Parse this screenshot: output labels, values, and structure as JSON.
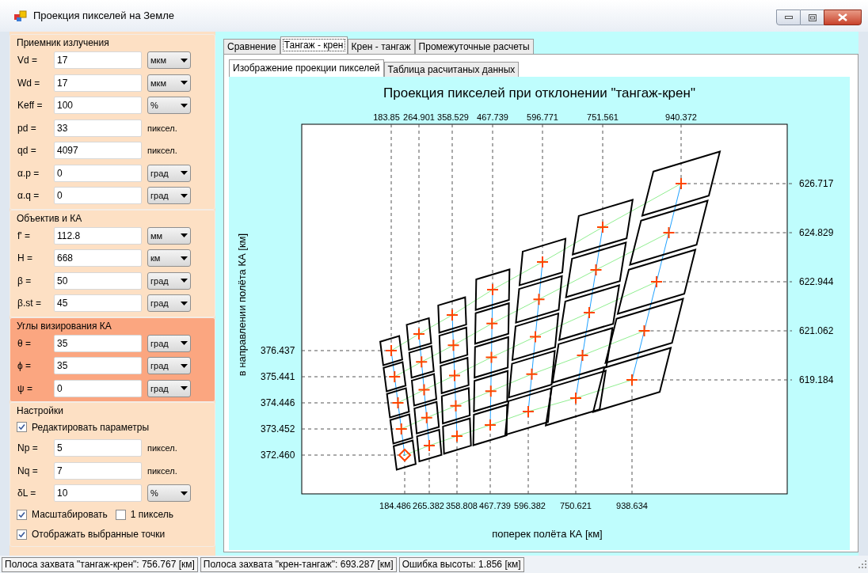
{
  "window": {
    "title": "Проекция пикселей на Земле"
  },
  "groups": [
    {
      "title": "Приемник излучения",
      "highlighted": false,
      "rows": [
        {
          "kind": "field",
          "label": "Vd =",
          "value": "17",
          "unit": {
            "kind": "dropdown",
            "text": "мкм"
          }
        },
        {
          "kind": "field",
          "label": "Wd =",
          "value": "17",
          "unit": {
            "kind": "dropdown",
            "text": "мкм"
          }
        },
        {
          "kind": "field",
          "label": "Keff =",
          "value": "100",
          "unit": {
            "kind": "dropdown",
            "text": "%"
          }
        },
        {
          "kind": "field",
          "label": "pd =",
          "value": "33",
          "unit": {
            "kind": "text",
            "text": "пиксел."
          }
        },
        {
          "kind": "field",
          "label": "qd =",
          "value": "4097",
          "unit": {
            "kind": "text",
            "text": "пиксел."
          }
        },
        {
          "kind": "field",
          "label": "α.p =",
          "value": "0",
          "unit": {
            "kind": "dropdown",
            "text": "град"
          }
        },
        {
          "kind": "field",
          "label": "α.q =",
          "value": "0",
          "unit": {
            "kind": "dropdown",
            "text": "град"
          }
        }
      ]
    },
    {
      "title": "Объектив и КА",
      "highlighted": false,
      "rows": [
        {
          "kind": "field",
          "label": "f' =",
          "value": "112.8",
          "unit": {
            "kind": "dropdown",
            "text": "мм"
          }
        },
        {
          "kind": "field",
          "label": "H =",
          "value": "668",
          "unit": {
            "kind": "dropdown",
            "text": "км"
          }
        },
        {
          "kind": "field",
          "label": "β =",
          "value": "50",
          "unit": {
            "kind": "dropdown",
            "text": "град"
          }
        },
        {
          "kind": "field",
          "label": "β.st =",
          "value": "45",
          "unit": {
            "kind": "dropdown",
            "text": "град"
          }
        }
      ]
    },
    {
      "title": "Углы визирования КА",
      "highlighted": true,
      "rows": [
        {
          "kind": "field",
          "label": "θ =",
          "value": "35",
          "unit": {
            "kind": "dropdown",
            "text": "град"
          }
        },
        {
          "kind": "field",
          "label": "ϕ =",
          "value": "35",
          "unit": {
            "kind": "dropdown",
            "text": "град"
          }
        },
        {
          "kind": "field",
          "label": "ψ =",
          "value": "0",
          "unit": {
            "kind": "dropdown",
            "text": "град"
          }
        }
      ]
    },
    {
      "title": "Настройки",
      "highlighted": false,
      "rows": [
        {
          "kind": "checks",
          "items": [
            {
              "label": "Редактировать параметры",
              "checked": true
            }
          ]
        },
        {
          "kind": "field",
          "label": "Np =",
          "value": "5",
          "unit": {
            "kind": "text",
            "text": "пиксел."
          }
        },
        {
          "kind": "field",
          "label": "Nq =",
          "value": "7",
          "unit": {
            "kind": "text",
            "text": "пиксел."
          }
        },
        {
          "kind": "field",
          "label": "δL =",
          "value": "10",
          "unit": {
            "kind": "dropdown",
            "text": "%"
          }
        },
        {
          "kind": "checks",
          "items": [
            {
              "label": "Масштабировать",
              "checked": true
            },
            {
              "label": "1 пиксель",
              "checked": false
            }
          ]
        },
        {
          "kind": "checks",
          "items": [
            {
              "label": "Отображать выбранные точки",
              "checked": true
            }
          ]
        }
      ]
    }
  ],
  "tabs": [
    {
      "label": "Сравнение",
      "selected": false
    },
    {
      "label": "Тангаж - крен",
      "selected": true
    },
    {
      "label": "Крен - тангаж",
      "selected": false
    },
    {
      "label": "Промежуточные расчеты",
      "selected": false
    }
  ],
  "subtabs": [
    {
      "label": "Изображение проекции пикселей",
      "selected": true
    },
    {
      "label": "Таблица расчитаных данных",
      "selected": false
    }
  ],
  "plot": {
    "title": "Проекция пикселей при отклонении \"тангаж-крен\"",
    "xlabel": "поперек полёта КА [км]",
    "ylabel": "в направлении полёта КА [км]",
    "top_ticks": [
      "183.85",
      "264.901",
      "358.529",
      "467.739",
      "596.771",
      "751.561",
      "940.372"
    ],
    "bottom_ticks": [
      "184.486",
      "265.382",
      "358.808",
      "467.739",
      "596.382",
      "750.621",
      "938.634"
    ],
    "left_ticks": [
      "376.437",
      "375.441",
      "374.446",
      "373.452",
      "372.460"
    ],
    "right_ticks": [
      "626.717",
      "624.829",
      "622.944",
      "621.062",
      "619.184"
    ]
  },
  "status_bar": [
    "Полоса захвата \"тангаж-крен\": 756.767 [км]",
    "Полоса захвата \"крен-тангаж\": 693.287 [км]",
    "Ошибка высоты: 1.856 [км]"
  ]
}
